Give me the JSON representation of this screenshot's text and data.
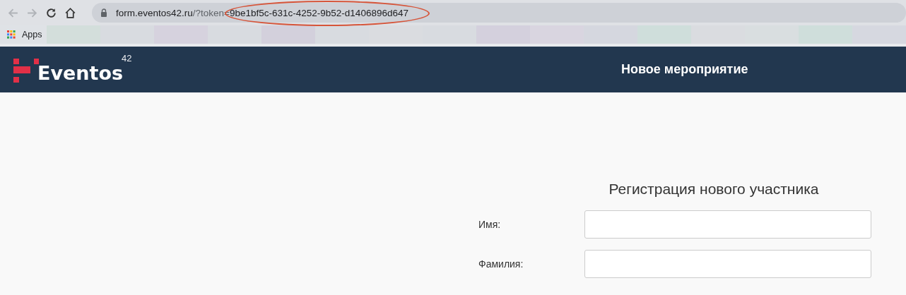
{
  "browser": {
    "url_host": "form.eventos42.ru",
    "url_path": "/?token=",
    "url_token": "9be1bf5c-631c-4252-9b52-d1406896d647",
    "bookmarks": [
      {
        "label": "Apps"
      }
    ],
    "blurred_bookmarks": [
      {
        "color": "#d3dedb"
      },
      {
        "color": "#d8dbe0"
      },
      {
        "color": "#d6d2de"
      },
      {
        "color": "#d8dbe0"
      },
      {
        "color": "#d3d0dc"
      },
      {
        "color": "#d8dbe0"
      },
      {
        "color": "#dadce0"
      },
      {
        "color": "#d8dbe0"
      },
      {
        "color": "#d4d0dd"
      },
      {
        "color": "#d9d5e0"
      },
      {
        "color": "#d5d7df"
      },
      {
        "color": "#cfdedb"
      },
      {
        "color": "#dadce0"
      },
      {
        "color": "#d9dee0"
      },
      {
        "color": "#cfdedb"
      },
      {
        "color": "#d6d8e0"
      }
    ]
  },
  "header": {
    "logo_text": "Eventos",
    "logo_sup": "42",
    "title": "Новое мероприятие"
  },
  "form": {
    "title": "Регистрация нового участника",
    "fields": [
      {
        "label": "Имя:"
      },
      {
        "label": "Фамилия:"
      }
    ]
  }
}
